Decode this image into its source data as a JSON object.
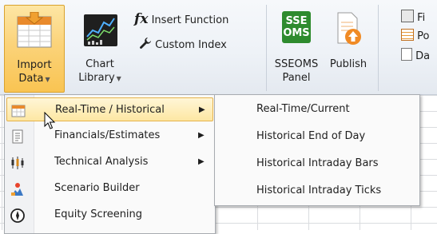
{
  "ribbon": {
    "import_data": {
      "line1": "Import",
      "line2": "Data"
    },
    "chart_library": {
      "line1": "Chart",
      "line2": "Library"
    },
    "insert_function": "Insert Function",
    "custom_index": "Custom Index",
    "sseoms": {
      "icon_text_1": "SSE",
      "icon_text_2": "OMS",
      "line1": "SSEOMS",
      "line2": "Panel"
    },
    "publish": "Publish",
    "right_items": [
      "Fi",
      "Po",
      "Da"
    ]
  },
  "menu": {
    "items": [
      {
        "label": "Real-Time / Historical",
        "has_submenu": true,
        "highlighted": true,
        "icon": "table-icon"
      },
      {
        "label": "Financials/Estimates",
        "has_submenu": true,
        "highlighted": false,
        "icon": "document-icon"
      },
      {
        "label": "Technical Analysis",
        "has_submenu": true,
        "highlighted": false,
        "icon": "candlestick-icon"
      },
      {
        "label": "Scenario Builder",
        "has_submenu": false,
        "highlighted": false,
        "icon": "scenario-icon"
      },
      {
        "label": "Equity Screening",
        "has_submenu": false,
        "highlighted": false,
        "icon": "compass-icon"
      }
    ]
  },
  "submenu": {
    "items": [
      {
        "label": "Real-Time/Current"
      },
      {
        "label": "Historical End of Day"
      },
      {
        "label": "Historical Intraday Bars"
      },
      {
        "label": "Historical Intraday Ticks"
      }
    ]
  },
  "colors": {
    "highlight": "#fde7a3",
    "highlight_border": "#e6b24a",
    "sseoms_green": "#2e8b2e",
    "publish_orange": "#f08a24"
  }
}
